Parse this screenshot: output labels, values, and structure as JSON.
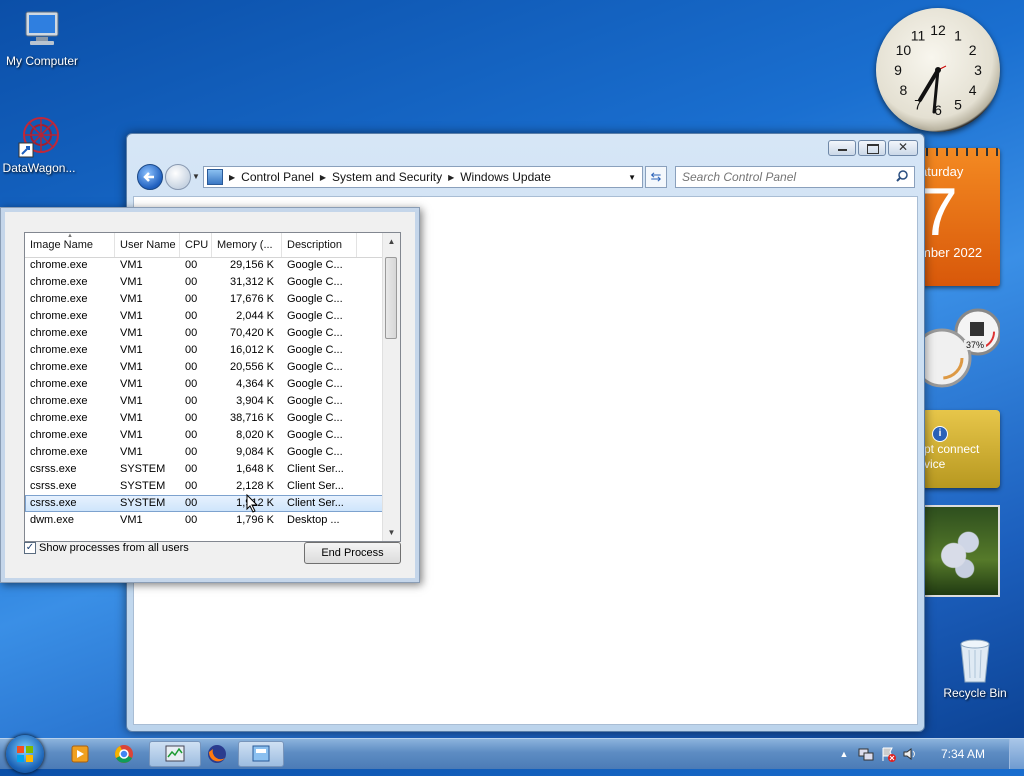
{
  "desktop": {
    "icons": [
      {
        "label": "My Computer",
        "icon": "computer-icon"
      },
      {
        "label": "DataWagon...",
        "icon": "datawagon-icon"
      },
      {
        "label": "Recycle Bin",
        "icon": "recycle-bin-icon"
      }
    ]
  },
  "gadgets": {
    "clock_numbers": [
      "12",
      "1",
      "2",
      "3",
      "4",
      "5",
      "6",
      "7",
      "8",
      "9",
      "10",
      "11"
    ],
    "calendar": {
      "dow": "aturday",
      "day": "7",
      "month": "mber 2022"
    },
    "meter": {
      "value": "37%"
    },
    "info": {
      "text": "pt connect\nvice"
    }
  },
  "control_panel": {
    "breadcrumb": [
      "Control Panel",
      "System and Security",
      "Windows Update"
    ],
    "search_placeholder": "Search Control Panel"
  },
  "task_manager": {
    "columns": [
      "Image Name",
      "User Name",
      "CPU",
      "Memory (...",
      "Description"
    ],
    "rows": [
      [
        "chrome.exe",
        "VM1",
        "00",
        "29,156 K",
        "Google C..."
      ],
      [
        "chrome.exe",
        "VM1",
        "00",
        "31,312 K",
        "Google C..."
      ],
      [
        "chrome.exe",
        "VM1",
        "00",
        "17,676 K",
        "Google C..."
      ],
      [
        "chrome.exe",
        "VM1",
        "00",
        "2,044 K",
        "Google C..."
      ],
      [
        "chrome.exe",
        "VM1",
        "00",
        "70,420 K",
        "Google C..."
      ],
      [
        "chrome.exe",
        "VM1",
        "00",
        "16,012 K",
        "Google C..."
      ],
      [
        "chrome.exe",
        "VM1",
        "00",
        "20,556 K",
        "Google C..."
      ],
      [
        "chrome.exe",
        "VM1",
        "00",
        "4,364 K",
        "Google C..."
      ],
      [
        "chrome.exe",
        "VM1",
        "00",
        "3,904 K",
        "Google C..."
      ],
      [
        "chrome.exe",
        "VM1",
        "00",
        "38,716 K",
        "Google C..."
      ],
      [
        "chrome.exe",
        "VM1",
        "00",
        "8,020 K",
        "Google C..."
      ],
      [
        "chrome.exe",
        "VM1",
        "00",
        "9,084 K",
        "Google C..."
      ],
      [
        "csrss.exe",
        "SYSTEM",
        "00",
        "1,648 K",
        "Client Ser..."
      ],
      [
        "csrss.exe",
        "SYSTEM",
        "00",
        "2,128 K",
        "Client Ser..."
      ],
      [
        "csrss.exe",
        "SYSTEM",
        "00",
        "1,912 K",
        "Client Ser..."
      ],
      [
        "dwm.exe",
        "VM1",
        "00",
        "1,796 K",
        "Desktop ..."
      ]
    ],
    "selected_row": 14,
    "show_all_users_label": "Show processes from all users",
    "show_all_users_checked": true,
    "end_process_label": "End Process"
  },
  "taskbar": {
    "time": "7:34 AM",
    "items": [
      "media-player-icon",
      "chrome-icon",
      "task-manager-icon",
      "firefox-icon",
      "control-panel-icon"
    ]
  },
  "colors": {
    "accent": "#1f5fbe",
    "calendar": "#e8660f"
  }
}
